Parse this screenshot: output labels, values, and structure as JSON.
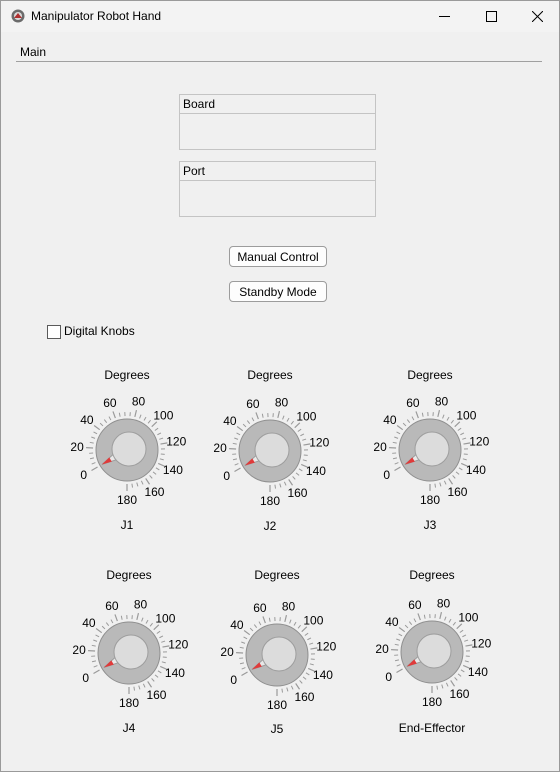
{
  "window": {
    "title": "Manipulator Robot Hand",
    "controls": [
      "minimize",
      "maximize",
      "close"
    ]
  },
  "menu": {
    "main_label": "Main"
  },
  "board": {
    "label": "Board",
    "value": ""
  },
  "port": {
    "label": "Port",
    "value": ""
  },
  "buttons": {
    "manual_control": "Manual Control",
    "standby_mode": "Standby Mode"
  },
  "digital_knobs": {
    "label": "Digital Knobs",
    "checked": false
  },
  "knob_scale": {
    "min": 0,
    "max": 180,
    "major_labels": [
      "0",
      "20",
      "40",
      "60",
      "80",
      "100",
      "120",
      "140",
      "160",
      "180"
    ],
    "minor_step": 5
  },
  "knobs": [
    {
      "id": "j1",
      "title": "Degrees",
      "name": "J1",
      "value": 0
    },
    {
      "id": "j2",
      "title": "Degrees",
      "name": "J2",
      "value": 0
    },
    {
      "id": "j3",
      "title": "Degrees",
      "name": "J3",
      "value": 0
    },
    {
      "id": "j4",
      "title": "Degrees",
      "name": "J4",
      "value": 0
    },
    {
      "id": "j5",
      "title": "Degrees",
      "name": "J5",
      "value": 0
    },
    {
      "id": "end_effector",
      "title": "Degrees",
      "name": "End-Effector",
      "value": 0
    }
  ],
  "colors": {
    "indicator": "#e03a3a",
    "knob_ring": "#b9b9b9",
    "knob_face": "#dcdcdc",
    "tick": "#9a9a9a"
  }
}
